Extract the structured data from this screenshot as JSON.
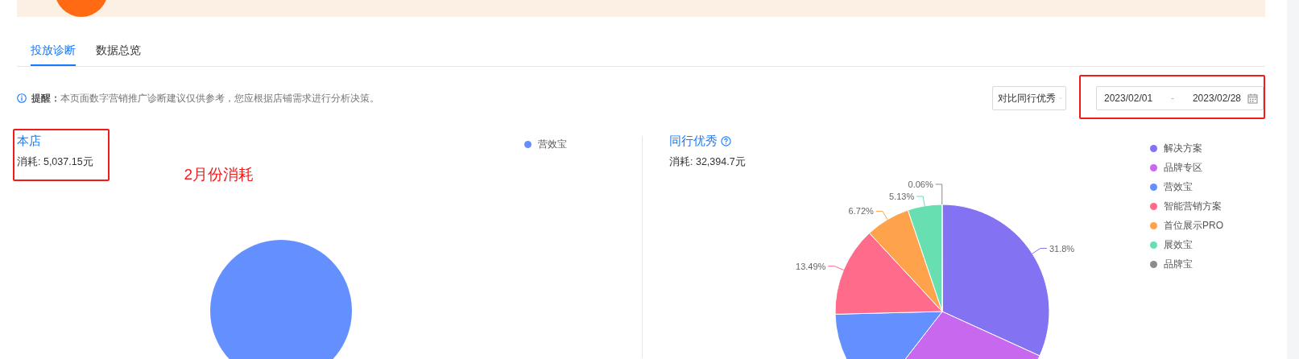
{
  "tabs": [
    {
      "label": "投放诊断",
      "selected": true
    },
    {
      "label": "数据总览",
      "selected": false
    }
  ],
  "notice": "**提醒：**本页面数字营销推广诊断建议仅供参考，您应根据店铺需求进行分析决策。",
  "compare_select": {
    "value": "对比同行优秀"
  },
  "date_range": {
    "start": "2023/02/01",
    "separator": "-",
    "end": "2023/02/28",
    "highlighted": true
  },
  "store": {
    "title": "本店",
    "spend": "消耗: 5,037.15元",
    "highlighted": true,
    "chart_data": {
      "type": "pie",
      "categories": [
        "营效宝"
      ],
      "values": [
        100
      ],
      "colors": [
        "#6490ff"
      ]
    }
  },
  "annotation": "2月份消耗",
  "peers": {
    "title": "同行优秀",
    "spend": "消耗: 32,394.7元",
    "chart_data": {
      "type": "pie",
      "categories": [
        "解决方案",
        "品牌专区",
        "营效宝",
        "智能营销方案",
        "首位展示PRO",
        "展效宝",
        "品牌宝"
      ],
      "values": [
        31.8,
        28.7,
        14.1,
        13.49,
        6.72,
        5.13,
        0.06
      ],
      "colors": [
        "#8373f3",
        "#c868ef",
        "#6490ff",
        "#ff6b8a",
        "#ffa24c",
        "#67dfb0",
        "#8c8c8c"
      ],
      "value_labels": [
        "31.8%",
        null,
        null,
        "13.49%",
        "6.72%",
        "5.13%",
        "0.06%"
      ]
    }
  }
}
